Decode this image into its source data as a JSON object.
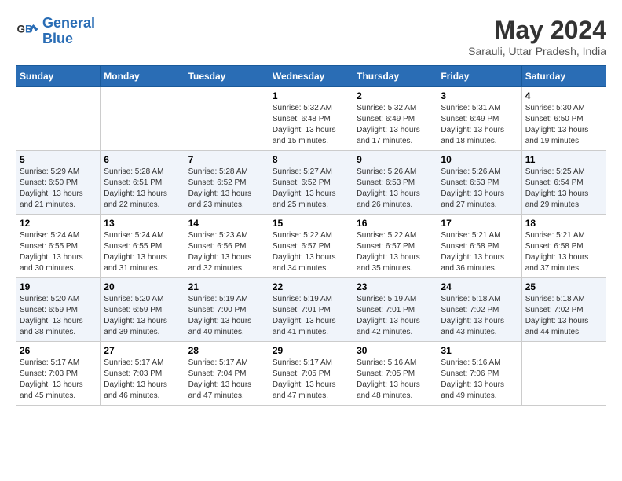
{
  "header": {
    "logo_line1": "General",
    "logo_line2": "Blue",
    "month": "May 2024",
    "location": "Sarauli, Uttar Pradesh, India"
  },
  "weekdays": [
    "Sunday",
    "Monday",
    "Tuesday",
    "Wednesday",
    "Thursday",
    "Friday",
    "Saturday"
  ],
  "weeks": [
    [
      {
        "day": "",
        "info": ""
      },
      {
        "day": "",
        "info": ""
      },
      {
        "day": "",
        "info": ""
      },
      {
        "day": "1",
        "info": "Sunrise: 5:32 AM\nSunset: 6:48 PM\nDaylight: 13 hours\nand 15 minutes."
      },
      {
        "day": "2",
        "info": "Sunrise: 5:32 AM\nSunset: 6:49 PM\nDaylight: 13 hours\nand 17 minutes."
      },
      {
        "day": "3",
        "info": "Sunrise: 5:31 AM\nSunset: 6:49 PM\nDaylight: 13 hours\nand 18 minutes."
      },
      {
        "day": "4",
        "info": "Sunrise: 5:30 AM\nSunset: 6:50 PM\nDaylight: 13 hours\nand 19 minutes."
      }
    ],
    [
      {
        "day": "5",
        "info": "Sunrise: 5:29 AM\nSunset: 6:50 PM\nDaylight: 13 hours\nand 21 minutes."
      },
      {
        "day": "6",
        "info": "Sunrise: 5:28 AM\nSunset: 6:51 PM\nDaylight: 13 hours\nand 22 minutes."
      },
      {
        "day": "7",
        "info": "Sunrise: 5:28 AM\nSunset: 6:52 PM\nDaylight: 13 hours\nand 23 minutes."
      },
      {
        "day": "8",
        "info": "Sunrise: 5:27 AM\nSunset: 6:52 PM\nDaylight: 13 hours\nand 25 minutes."
      },
      {
        "day": "9",
        "info": "Sunrise: 5:26 AM\nSunset: 6:53 PM\nDaylight: 13 hours\nand 26 minutes."
      },
      {
        "day": "10",
        "info": "Sunrise: 5:26 AM\nSunset: 6:53 PM\nDaylight: 13 hours\nand 27 minutes."
      },
      {
        "day": "11",
        "info": "Sunrise: 5:25 AM\nSunset: 6:54 PM\nDaylight: 13 hours\nand 29 minutes."
      }
    ],
    [
      {
        "day": "12",
        "info": "Sunrise: 5:24 AM\nSunset: 6:55 PM\nDaylight: 13 hours\nand 30 minutes."
      },
      {
        "day": "13",
        "info": "Sunrise: 5:24 AM\nSunset: 6:55 PM\nDaylight: 13 hours\nand 31 minutes."
      },
      {
        "day": "14",
        "info": "Sunrise: 5:23 AM\nSunset: 6:56 PM\nDaylight: 13 hours\nand 32 minutes."
      },
      {
        "day": "15",
        "info": "Sunrise: 5:22 AM\nSunset: 6:57 PM\nDaylight: 13 hours\nand 34 minutes."
      },
      {
        "day": "16",
        "info": "Sunrise: 5:22 AM\nSunset: 6:57 PM\nDaylight: 13 hours\nand 35 minutes."
      },
      {
        "day": "17",
        "info": "Sunrise: 5:21 AM\nSunset: 6:58 PM\nDaylight: 13 hours\nand 36 minutes."
      },
      {
        "day": "18",
        "info": "Sunrise: 5:21 AM\nSunset: 6:58 PM\nDaylight: 13 hours\nand 37 minutes."
      }
    ],
    [
      {
        "day": "19",
        "info": "Sunrise: 5:20 AM\nSunset: 6:59 PM\nDaylight: 13 hours\nand 38 minutes."
      },
      {
        "day": "20",
        "info": "Sunrise: 5:20 AM\nSunset: 6:59 PM\nDaylight: 13 hours\nand 39 minutes."
      },
      {
        "day": "21",
        "info": "Sunrise: 5:19 AM\nSunset: 7:00 PM\nDaylight: 13 hours\nand 40 minutes."
      },
      {
        "day": "22",
        "info": "Sunrise: 5:19 AM\nSunset: 7:01 PM\nDaylight: 13 hours\nand 41 minutes."
      },
      {
        "day": "23",
        "info": "Sunrise: 5:19 AM\nSunset: 7:01 PM\nDaylight: 13 hours\nand 42 minutes."
      },
      {
        "day": "24",
        "info": "Sunrise: 5:18 AM\nSunset: 7:02 PM\nDaylight: 13 hours\nand 43 minutes."
      },
      {
        "day": "25",
        "info": "Sunrise: 5:18 AM\nSunset: 7:02 PM\nDaylight: 13 hours\nand 44 minutes."
      }
    ],
    [
      {
        "day": "26",
        "info": "Sunrise: 5:17 AM\nSunset: 7:03 PM\nDaylight: 13 hours\nand 45 minutes."
      },
      {
        "day": "27",
        "info": "Sunrise: 5:17 AM\nSunset: 7:03 PM\nDaylight: 13 hours\nand 46 minutes."
      },
      {
        "day": "28",
        "info": "Sunrise: 5:17 AM\nSunset: 7:04 PM\nDaylight: 13 hours\nand 47 minutes."
      },
      {
        "day": "29",
        "info": "Sunrise: 5:17 AM\nSunset: 7:05 PM\nDaylight: 13 hours\nand 47 minutes."
      },
      {
        "day": "30",
        "info": "Sunrise: 5:16 AM\nSunset: 7:05 PM\nDaylight: 13 hours\nand 48 minutes."
      },
      {
        "day": "31",
        "info": "Sunrise: 5:16 AM\nSunset: 7:06 PM\nDaylight: 13 hours\nand 49 minutes."
      },
      {
        "day": "",
        "info": ""
      }
    ]
  ]
}
